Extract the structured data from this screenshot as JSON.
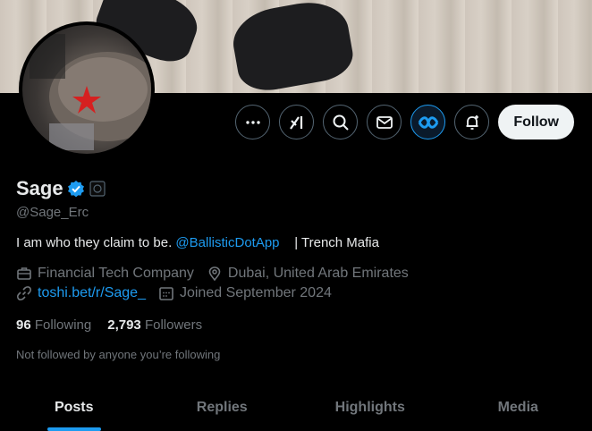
{
  "profile": {
    "name": "Sage",
    "handle": "@Sage_Erc",
    "bio_text": "I am who they claim to be.",
    "bio_mention": "@BallisticDotApp",
    "bio_suffix": "| Trench Mafia",
    "category": "Financial Tech Company",
    "location": "Dubai, United Arab Emirates",
    "website": "toshi.bet/r/Sage_",
    "joined": "Joined September 2024",
    "following_count": "96",
    "following_label": "Following",
    "followers_count": "2,793",
    "followers_label": "Followers",
    "not_followed": "Not followed by anyone you’re following"
  },
  "actions": {
    "more_icon": "more-icon",
    "grok_icon": "grok-icon",
    "search_icon": "search-icon",
    "message_icon": "mail-icon",
    "partner_icon": "partner-app-icon",
    "notify_icon": "bell-plus-icon",
    "follow_label": "Follow"
  },
  "tabs": [
    {
      "label": "Posts",
      "active": true
    },
    {
      "label": "Replies",
      "active": false
    },
    {
      "label": "Highlights",
      "active": false
    },
    {
      "label": "Media",
      "active": false
    }
  ],
  "colors": {
    "accent": "#1d9bf0",
    "background": "#000000",
    "muted": "#71767b",
    "text": "#e7e9ea"
  }
}
